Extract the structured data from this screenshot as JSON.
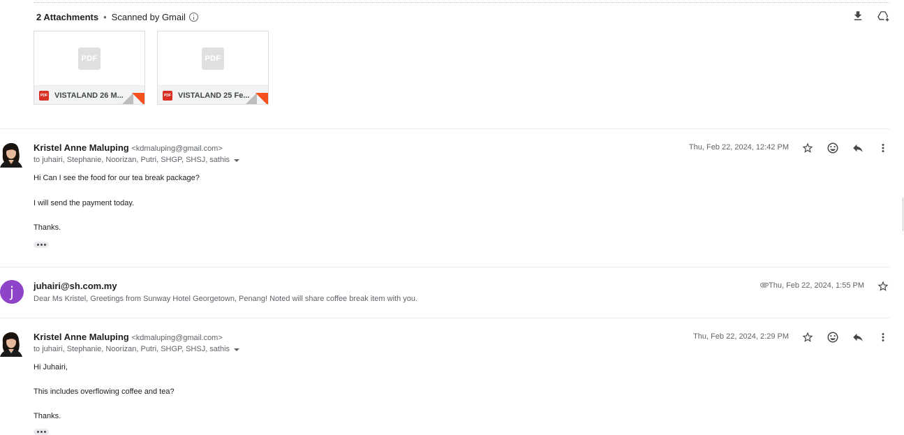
{
  "attachments": {
    "count_label": "2 Attachments",
    "scanned_label": "Scanned by Gmail",
    "files": [
      {
        "name": "VISTALAND 26 M...",
        "thumb_label": "PDF",
        "type_label": "PDF"
      },
      {
        "name": "VISTALAND 25 Fe...",
        "thumb_label": "PDF",
        "type_label": "PDF"
      }
    ]
  },
  "messages": [
    {
      "sender_name": "Kristel Anne Maluping",
      "sender_email": "<kdmaluping@gmail.com>",
      "recipients": "to juhairi, Stephanie, Noorizan, Putri, SHGP, SHSJ, sathis",
      "date": "Thu, Feb 22, 2024, 12:42 PM",
      "body": [
        "Hi Can I see the food for our tea break package?",
        "I will send the payment today.",
        "Thanks."
      ]
    },
    {
      "avatar_letter": "j",
      "sender_name": "juhairi@sh.com.my",
      "date": "Thu, Feb 22, 2024, 1:55 PM",
      "snippet": "Dear Ms Kristel, Greetings from Sunway Hotel Georgetown, Penang! Noted will share coffee break item with you."
    },
    {
      "sender_name": "Kristel Anne Maluping",
      "sender_email": "<kdmaluping@gmail.com>",
      "recipients": "to juhairi, Stephanie, Noorizan, Putri, SHGP, SHSJ, sathis",
      "date": "Thu, Feb 22, 2024, 2:29 PM",
      "body": [
        "Hi Juhairi,",
        "This includes overflowing coffee and tea?",
        "Thanks."
      ]
    }
  ],
  "colors": {
    "pdf_red": "#d93025",
    "avatar_purple": "#8e44c8",
    "corner_orange": "#f4511e"
  },
  "icons": [
    "info-icon",
    "download-icon",
    "add-to-drive-icon",
    "star-icon",
    "emoji-icon",
    "reply-icon",
    "more-vert-icon",
    "attachment-clip-icon"
  ]
}
